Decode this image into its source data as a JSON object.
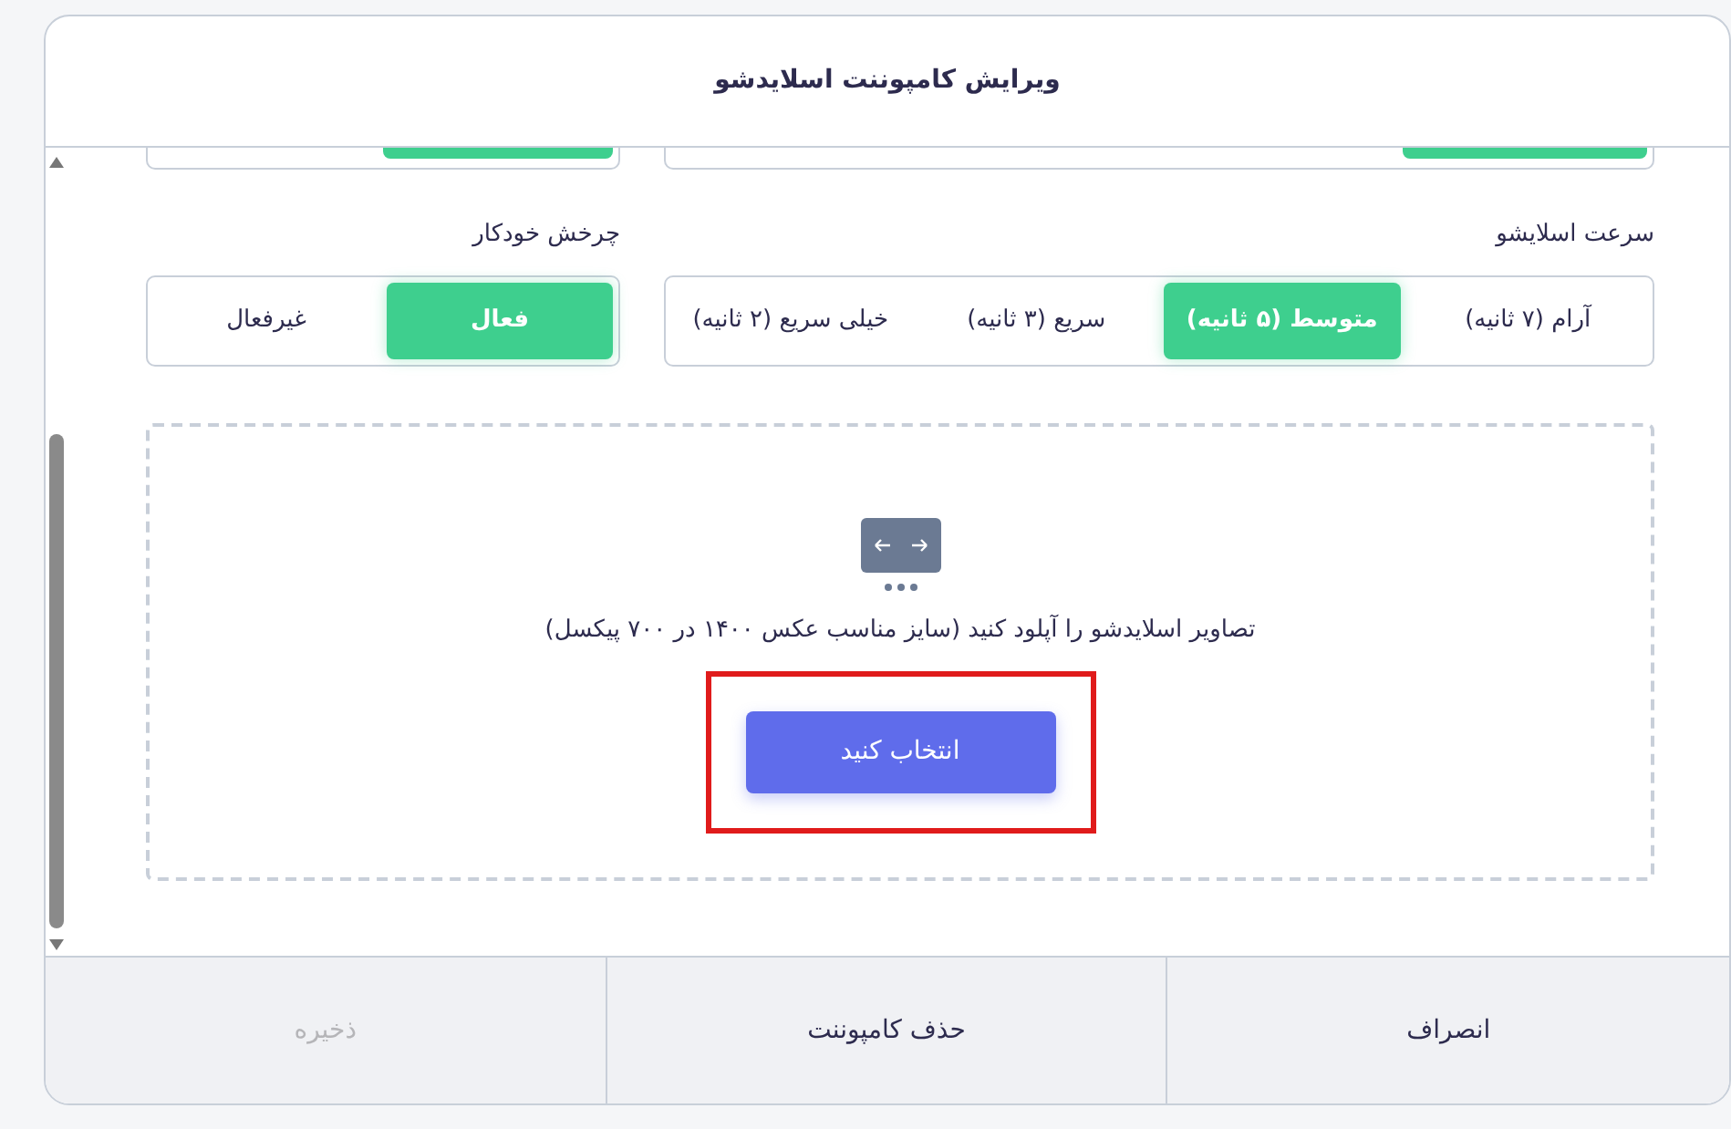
{
  "dialog": {
    "title": "ویرایش کامپوننت اسلایدشو"
  },
  "cut_off_row": [
    {
      "segments": [
        {
          "selected": true
        },
        {
          "selected": false
        },
        {
          "selected": false
        },
        {
          "selected": false
        }
      ]
    },
    {
      "segments": [
        {
          "selected": true
        },
        {
          "selected": false
        }
      ]
    }
  ],
  "settings": [
    {
      "label": "سرعت اسلایشو",
      "options": [
        {
          "label": "آرام (۷ ثانیه)",
          "selected": false
        },
        {
          "label": "متوسط (۵ ثانیه)",
          "selected": true
        },
        {
          "label": "سریع (۳ ثانیه)",
          "selected": false
        },
        {
          "label": "خیلی سریع (۲ ثانیه)",
          "selected": false
        }
      ]
    },
    {
      "label": "چرخش خودکار",
      "options": [
        {
          "label": "فعال",
          "selected": true
        },
        {
          "label": "غیرفعال",
          "selected": false
        }
      ]
    }
  ],
  "upload": {
    "hint": "تصاویر اسلایدشو را آپلود کنید (سایز مناسب عکس ۱۴۰۰ در ۷۰۰ پیکسل)",
    "button": "انتخاب کنید",
    "highlighted": true
  },
  "footer": [
    {
      "label": "انصراف",
      "disabled": false
    },
    {
      "label": "حذف کامپوننت",
      "disabled": false
    },
    {
      "label": "ذخیره",
      "disabled": true
    }
  ]
}
